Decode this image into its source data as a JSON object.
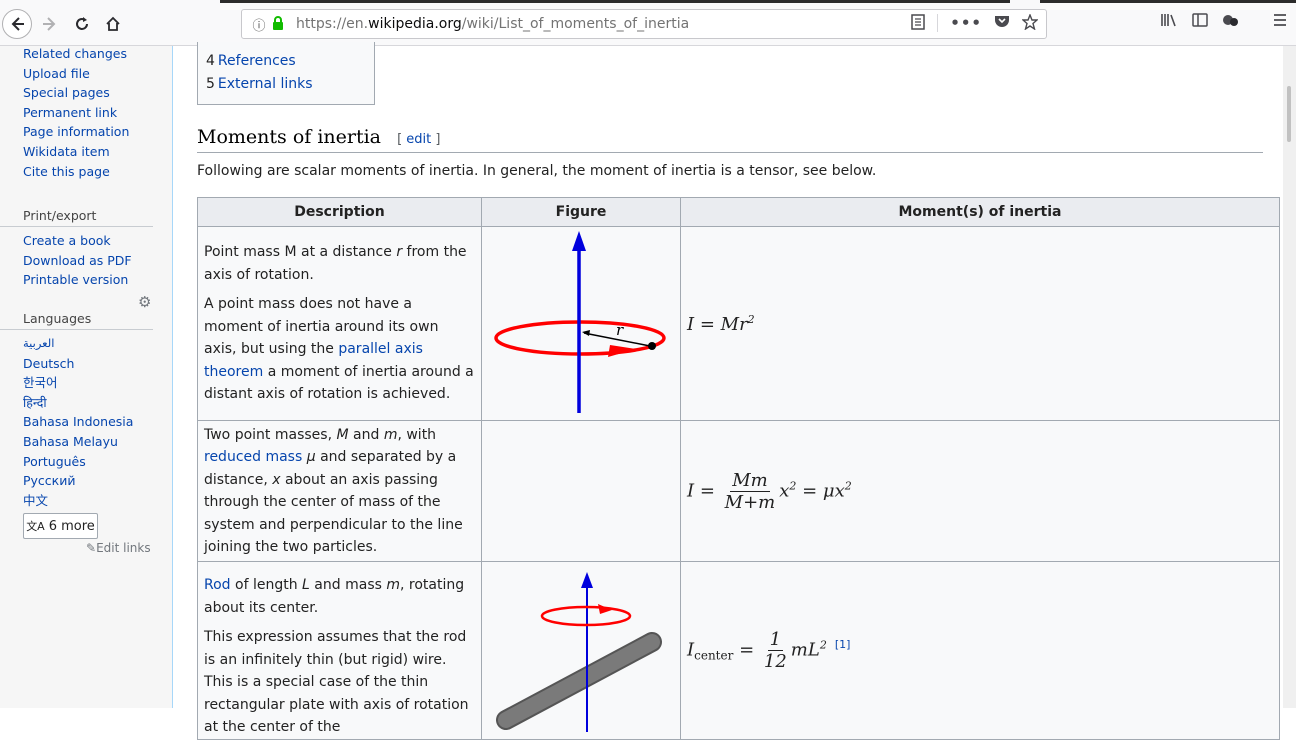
{
  "browser": {
    "url_prefix": "https://en.",
    "url_domain": "wikipedia.org",
    "url_path": "/wiki/List_of_moments_of_inertia"
  },
  "sidebar": {
    "tools": [
      "Related changes",
      "Upload file",
      "Special pages",
      "Permanent link",
      "Page information",
      "Wikidata item",
      "Cite this page"
    ],
    "print_heading": "Print/export",
    "print_items": [
      "Create a book",
      "Download as PDF",
      "Printable version"
    ],
    "languages_heading": "Languages",
    "languages": [
      "العربية",
      "Deutsch",
      "한국어",
      "हिन्दी",
      "Bahasa Indonesia",
      "Bahasa Melayu",
      "Português",
      "Русский",
      "中文"
    ],
    "more_label": "6 more",
    "edit_links": "Edit links"
  },
  "toc": {
    "items": [
      {
        "num": "4",
        "label": "References"
      },
      {
        "num": "5",
        "label": "External links"
      }
    ]
  },
  "section": {
    "title": "Moments of inertia",
    "edit_label": "edit",
    "intro": "Following are scalar moments of inertia. In general, the moment of inertia is a tensor, see below."
  },
  "table": {
    "headers": [
      "Description",
      "Figure",
      "Moment(s) of inertia"
    ],
    "row1": {
      "p1_a": "Point mass M at a distance ",
      "p1_r": "r",
      "p1_b": " from the axis of rotation.",
      "p2_a": "A point mass does not have a moment of inertia around its own axis, but using the ",
      "p2_link": "parallel axis theorem",
      "p2_b": " a moment of inertia around a distant axis of rotation is achieved.",
      "formula": "I = Mr",
      "exp": "2"
    },
    "row2": {
      "a": "Two point masses, ",
      "M": "M",
      "and": " and ",
      "m": "m",
      "b": ", with ",
      "link": "reduced mass",
      "mu": " μ",
      "c": " and separated by a distance, ",
      "x": "x",
      "d": " about an axis passing through the center of mass of the system and perpendicular to the line joining the two particles.",
      "lhs": "I =",
      "num": "Mm",
      "den": "M+m",
      "rhs1": "x",
      "rhs_eq": " = μx",
      "exp": "2"
    },
    "row3": {
      "link": "Rod",
      "a": " of length ",
      "L": "L",
      "b": " and mass ",
      "m": "m",
      "c": ", rotating about its center.",
      "p2": "This expression assumes that the rod is an infinitely thin (but rigid) wire. This is a special case of the thin rectangular plate with axis of rotation at the center of the",
      "lhs": "I",
      "sub": "center",
      "eq": " =",
      "num": "1",
      "den": "12",
      "rhs": "mL",
      "exp": "2",
      "ref": "[1]"
    }
  },
  "colors": {
    "link": "#0645ad",
    "axis_blue": "#0000dd",
    "ring_red": "#ff0000"
  }
}
